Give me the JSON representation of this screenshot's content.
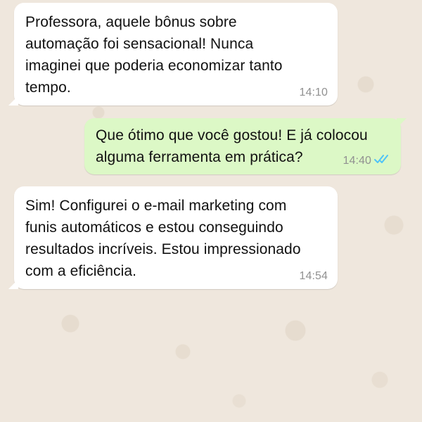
{
  "messages": [
    {
      "direction": "incoming",
      "text": "Professora, aquele bônus sobre\nautomação foi sensacional! Nunca\nimaginei que poderia economizar tanto\ntempo.",
      "time": "14:10"
    },
    {
      "direction": "outgoing",
      "text": "Que ótimo que você gostou! E já colocou\nalguma ferramenta em prática?",
      "time": "14:40",
      "status_icon": "double-check-read-icon",
      "status_color": "#4fc3f7"
    },
    {
      "direction": "incoming",
      "text": "Sim! Configurei o e-mail marketing com\nfunis automáticos e estou conseguindo\nresultados incríveis. Estou impressionado\ncom a eficiência.",
      "time": "14:54"
    }
  ],
  "colors": {
    "background": "#efe7dd",
    "incoming_bubble": "#ffffff",
    "outgoing_bubble": "#dcf8c6",
    "timestamp": "#919191"
  }
}
